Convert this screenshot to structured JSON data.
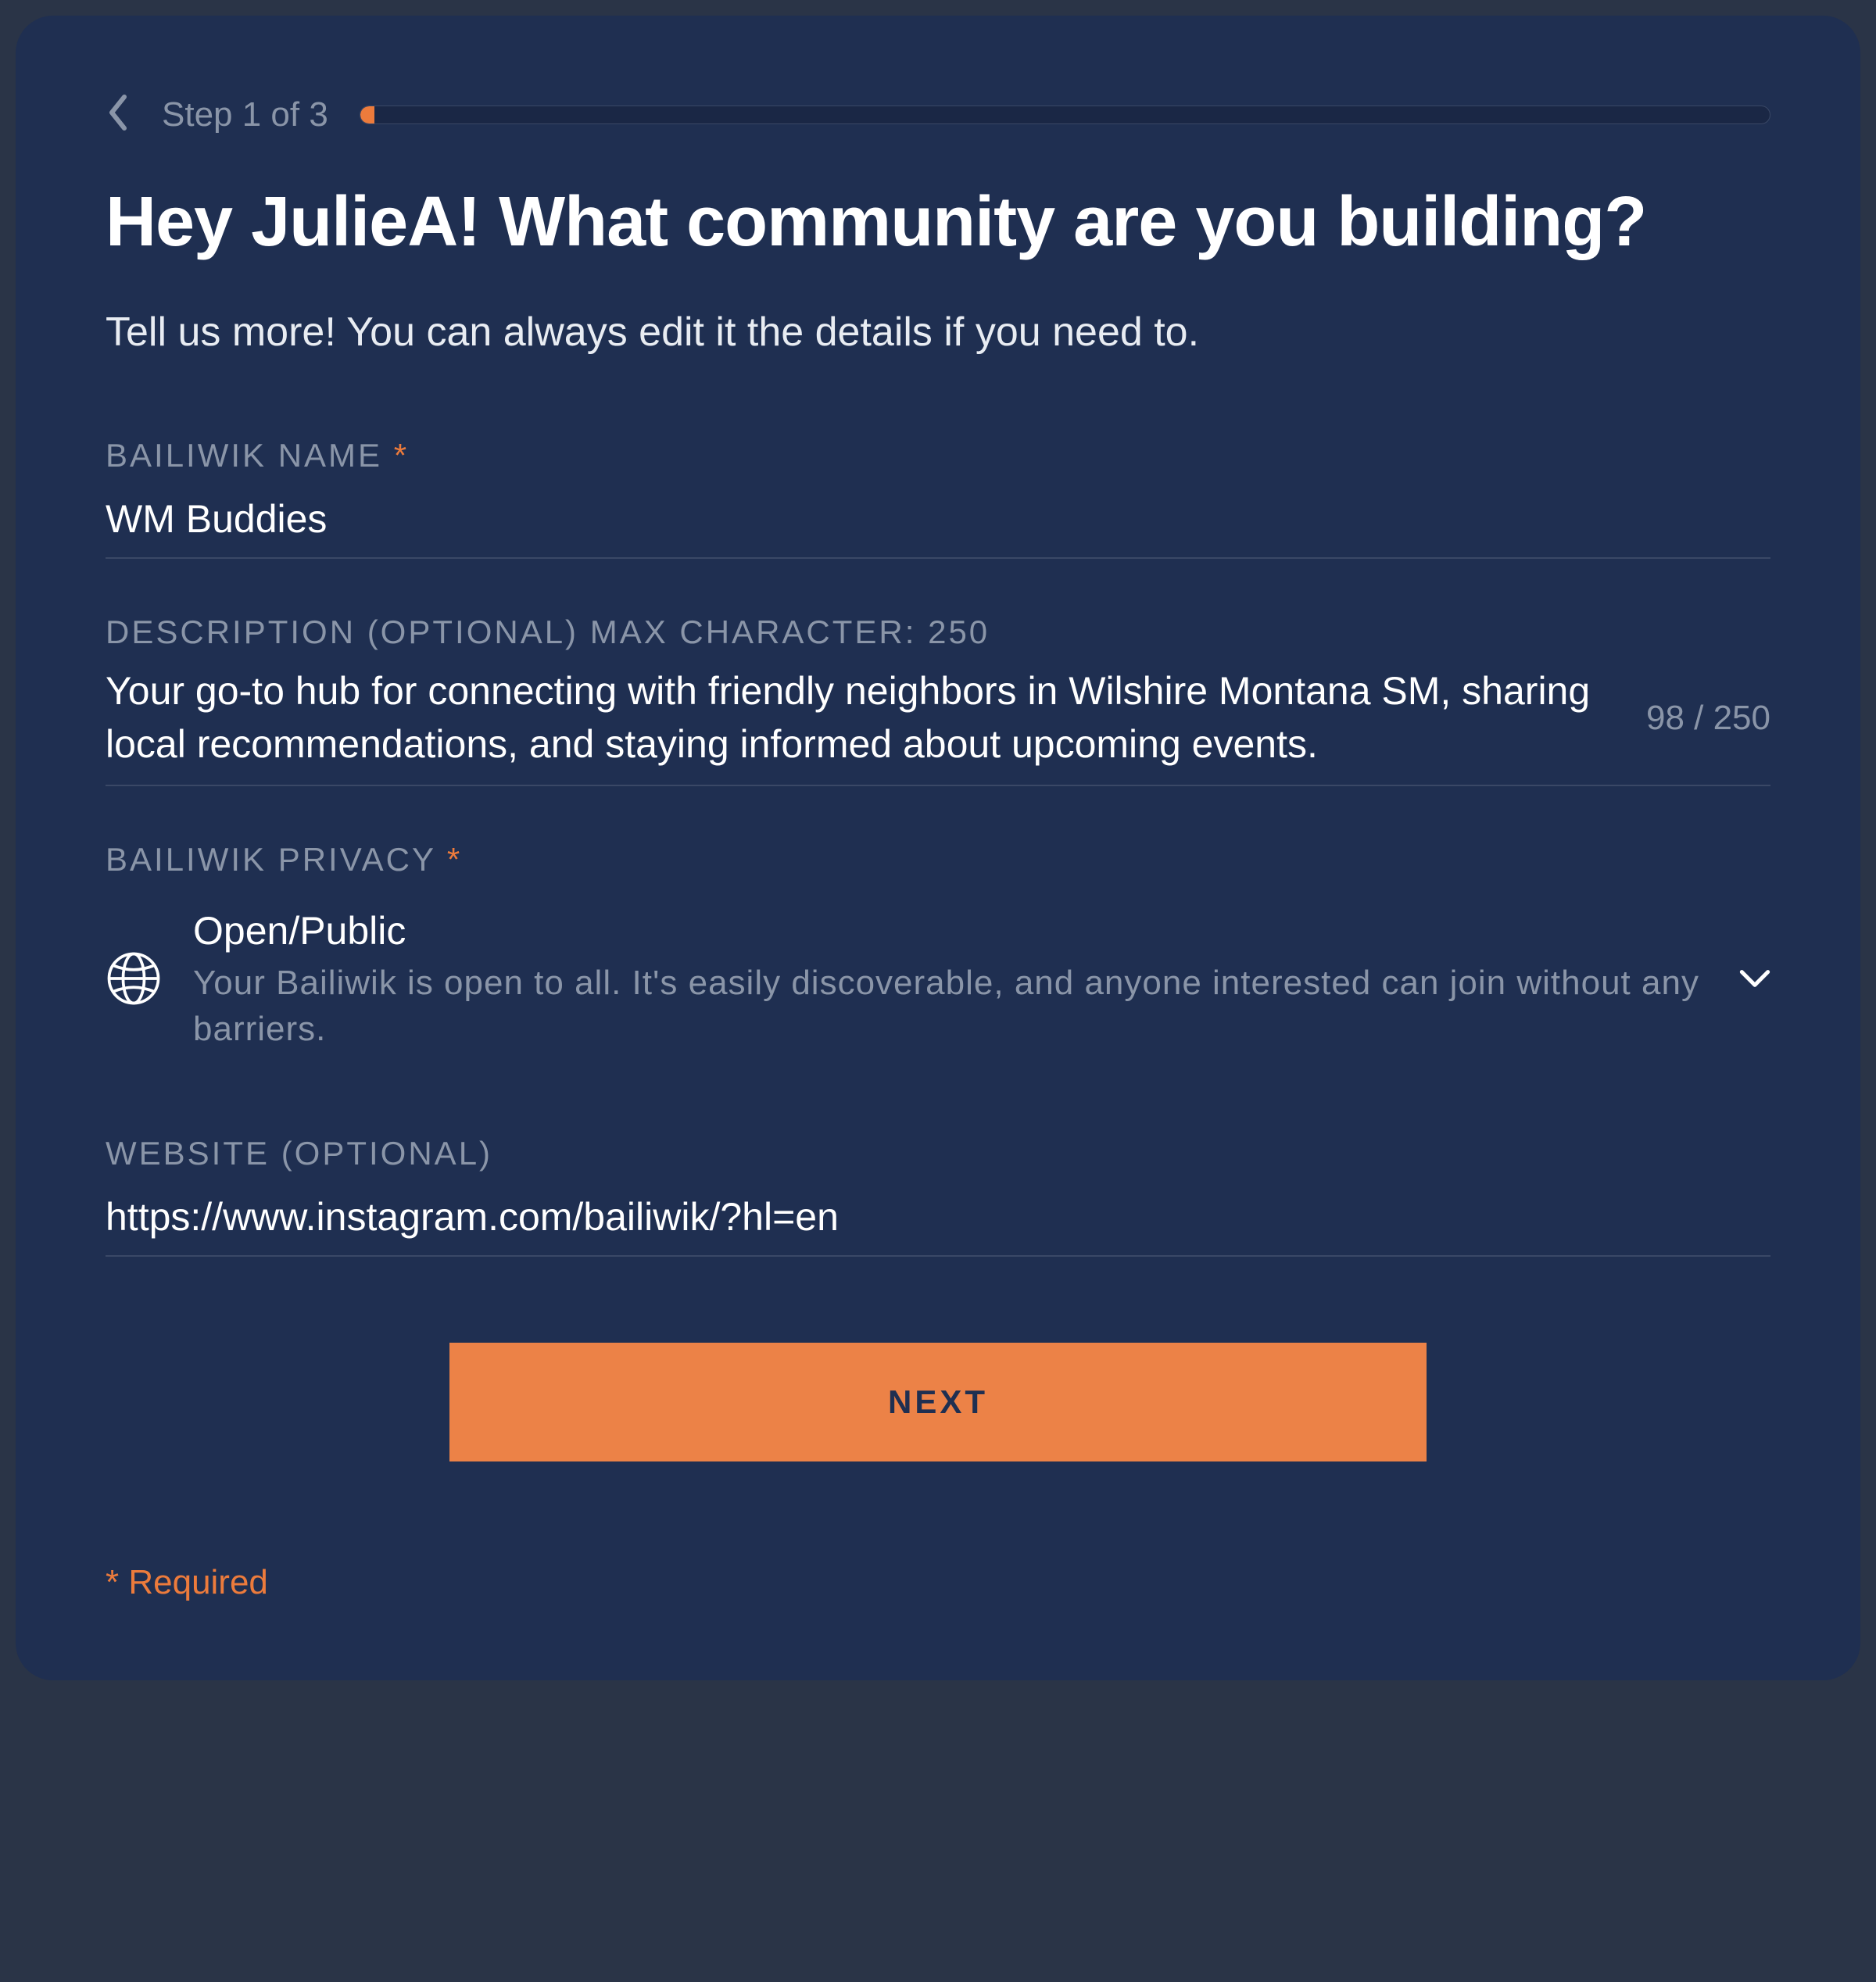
{
  "progress": {
    "step_label": "Step 1 of 3",
    "percent": 1
  },
  "heading": "Hey JulieA! What community are you building?",
  "subheading": "Tell us more! You can always edit it the details if you need to.",
  "fields": {
    "name": {
      "label": "BAILIWIK NAME",
      "required_star": "*",
      "value": "WM Buddies"
    },
    "description": {
      "label": "DESCRIPTION (OPTIONAL) MAX CHARACTER: 250",
      "value": "Your go-to hub for connecting with friendly neighbors in Wilshire Montana SM, sharing local recommendations, and staying informed about upcoming events.",
      "counter": "98 / 250"
    },
    "privacy": {
      "label": "BAILIWIK PRIVACY",
      "required_star": "*",
      "selected_title": "Open/Public",
      "selected_desc": "Your Bailiwik is open to all. It's easily discoverable, and anyone interested can join without any barriers."
    },
    "website": {
      "label": "WEBSITE (OPTIONAL)",
      "value": "https://www.instagram.com/bailiwik/?hl=en"
    }
  },
  "buttons": {
    "next": "NEXT"
  },
  "required_note": "* Required"
}
